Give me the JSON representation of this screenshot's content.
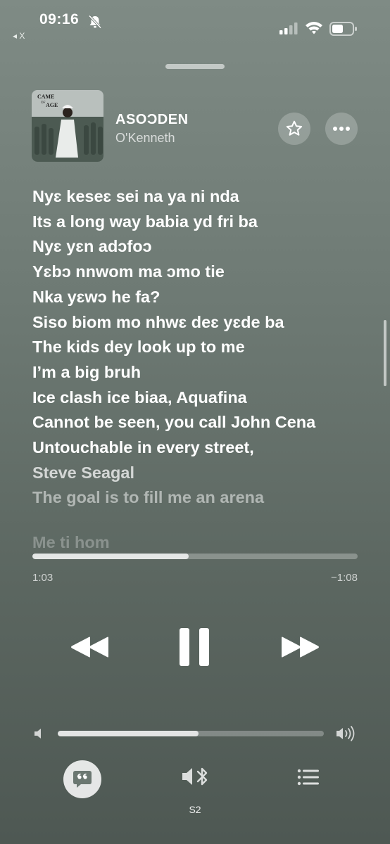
{
  "status": {
    "time": "09:16",
    "back_label": "X"
  },
  "now_playing": {
    "album_art_text": [
      "CAME",
      "OF",
      "AGE"
    ],
    "title": "ASOƆDEN",
    "artist": "O'Kenneth"
  },
  "lyrics": [
    "Nyɛ  keseɛ  sei na ya ni nda",
    "Its a  long way babia yd fri ba",
    "Nyɛ yɛn adɔfoɔ",
    "Yɛbɔ nnwom ma ɔmo tie",
    "Nka yɛwɔ he fa?",
    "Siso biom mo nhwɛ deɛ yɛde ba",
    "The kids dey look up to me",
    "I’m a big bruh",
    "Ice clash ice biaa, Aquafina",
    "Cannot be seen, you call John Cena",
    "Untouchable in every street,",
    "Steve Seagal",
    "The goal is to fill me an arena",
    "Me ti hom"
  ],
  "playback": {
    "elapsed": "1:03",
    "remaining": "−1:08",
    "progress": 0.48
  },
  "volume": {
    "level": 0.53
  },
  "output": {
    "device": "S2"
  },
  "icons": {
    "bell": "bell-slash-icon",
    "star": "star-icon",
    "more": "ellipsis-icon",
    "rewind": "backward-icon",
    "pause": "pause-icon",
    "forward": "forward-icon",
    "lyrics": "quote-bubble-icon",
    "speaker": "speaker-bluetooth-icon",
    "queue": "list-icon"
  }
}
